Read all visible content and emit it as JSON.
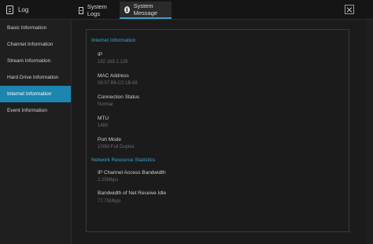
{
  "window": {
    "title": "Log",
    "tabs": [
      {
        "label": "System Logs"
      },
      {
        "label": "System Message"
      }
    ]
  },
  "sidebar": {
    "items": [
      {
        "label": "Basic Information"
      },
      {
        "label": "Channel Information"
      },
      {
        "label": "Stream Information"
      },
      {
        "label": "Hard Drive Information"
      },
      {
        "label": "Internet Information"
      },
      {
        "label": "Event Information"
      }
    ],
    "active_index": 4
  },
  "internet": {
    "section_title": "Internet Information",
    "ip_label": "IP",
    "ip_value": "192.168.1.128",
    "mac_label": "MAC Address",
    "mac_value": "08:07:B6:C0:1B:68",
    "connection_label": "Connection Status",
    "connection_value": "Normal",
    "mtu_label": "MTU",
    "mtu_value": "1480",
    "port_label": "Port Mode",
    "port_value": "100M Full Duplex"
  },
  "network": {
    "section_title": "Network Resource Statistics",
    "ip_channel_label": "IP Channel Access Bandwidth",
    "ip_channel_value": "2.25Mbps",
    "receive_label": "Bandwidth of Net Receive Idle",
    "receive_value": "77.75Mbps"
  },
  "colors": {
    "accent": "#1d86b0",
    "section_title": "#3aa6d0",
    "background": "#1a1a1a"
  }
}
